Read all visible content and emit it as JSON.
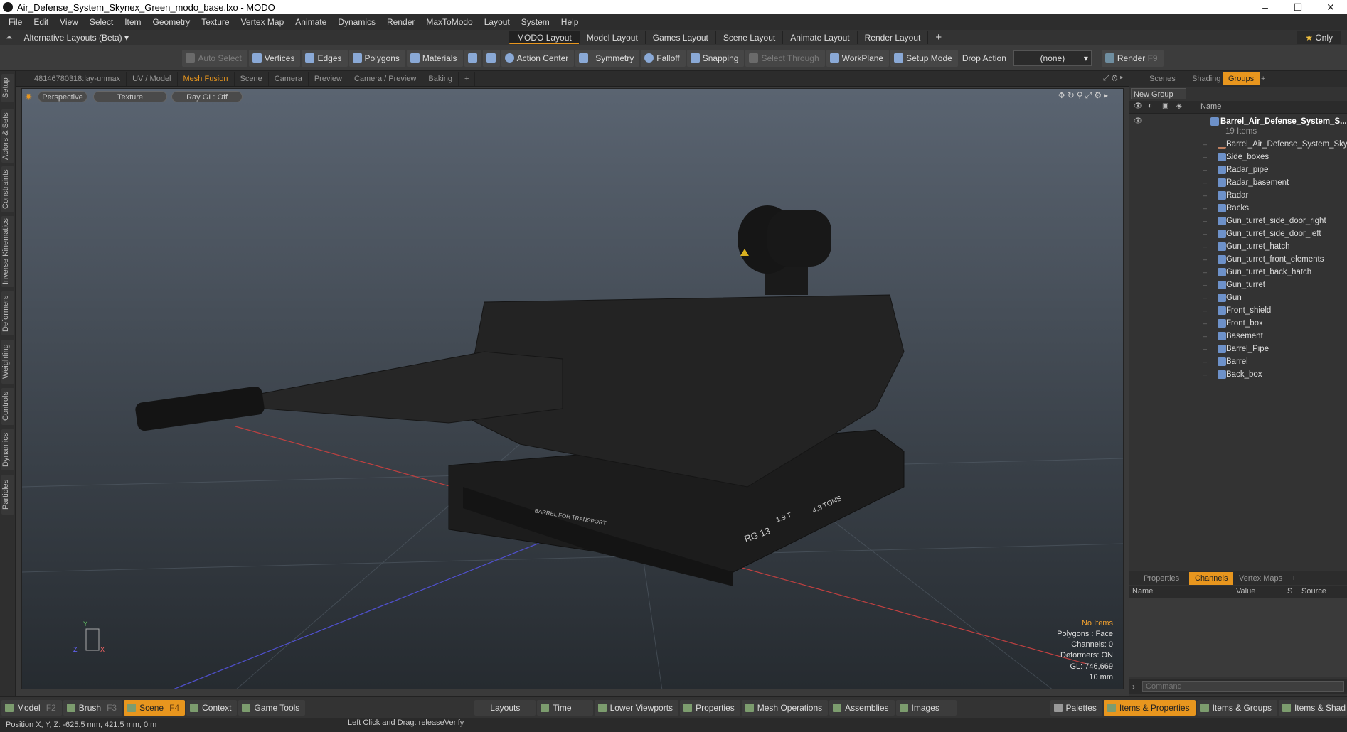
{
  "window": {
    "title": "Air_Defense_System_Skynex_Green_modo_base.lxo - MODO",
    "minimize": "–",
    "maximize": "☐",
    "close": "✕"
  },
  "menu": [
    "File",
    "Edit",
    "View",
    "Select",
    "Item",
    "Geometry",
    "Texture",
    "Vertex Map",
    "Animate",
    "Dynamics",
    "Render",
    "MaxToModo",
    "Layout",
    "System",
    "Help"
  ],
  "layout_bar": {
    "alt_layouts": "Alternative Layouts (Beta)",
    "tabs": [
      "MODO Layout",
      "Model Layout",
      "Games Layout",
      "Scene Layout",
      "Animate Layout",
      "Render Layout"
    ],
    "active_tab": "MODO Layout",
    "add": "+",
    "only": "Only"
  },
  "toolbar": {
    "auto_select": "Auto Select",
    "vertices": "Vertices",
    "edges": "Edges",
    "polygons": "Polygons",
    "materials": "Materials",
    "action_center": "Action Center",
    "symmetry": "Symmetry",
    "falloff": "Falloff",
    "snapping": "Snapping",
    "select_through": "Select Through",
    "workplane": "WorkPlane",
    "setup_mode": "Setup Mode",
    "drop_action": "Drop Action",
    "drop_value": "(none)",
    "render": "Render",
    "render_key": "F9"
  },
  "left_tabs": [
    "Setup",
    "Actors & Sets",
    "Constraints",
    "Inverse Kinematics",
    "Deformers",
    "Weighting",
    "Controls",
    "Dynamics",
    "Particles"
  ],
  "viewport_tabs": [
    "48146780318:lay-unmax",
    "UV / Model",
    "Mesh Fusion",
    "Scene",
    "Camera",
    "Preview",
    "Camera / Preview",
    "Baking"
  ],
  "viewport_tab_active": "Mesh Fusion",
  "viewport": {
    "view": "Perspective",
    "shading": "Texture",
    "raygl": "Ray GL: Off",
    "info": {
      "items": "No Items",
      "polygons": "Polygons : Face",
      "channels": "Channels: 0",
      "deformers": "Deformers: ON",
      "gl": "GL: 746,669",
      "scale": "10 mm"
    },
    "model_labels": {
      "barrel_transport": "BARREL FOR TRANSPORT",
      "rg": "RG 13",
      "weight": "4.3 TONS",
      "mark": "1.9 T"
    }
  },
  "right_panel": {
    "tabs": [
      "Scenes",
      "Shading",
      "Groups"
    ],
    "active_tab": "Groups",
    "new_group": "New Group",
    "col_name": "Name",
    "root": "Barrel_Air_Defense_System_S...",
    "root_count": "19 Items",
    "items": [
      "Barrel_Air_Defense_System_Sky ...",
      "Side_boxes",
      "Radar_pipe",
      "Radar_basement",
      "Radar",
      "Racks",
      "Gun_turret_side_door_right",
      "Gun_turret_side_door_left",
      "Gun_turret_hatch",
      "Gun_turret_front_elements",
      "Gun_turret_back_hatch",
      "Gun_turret",
      "Gun",
      "Front_shield",
      "Front_box",
      "Basement",
      "Barrel_Pipe",
      "Barrel",
      "Back_box"
    ],
    "lower_tabs": [
      "Properties",
      "Channels",
      "Vertex Maps"
    ],
    "lower_active": "Channels",
    "channel_cols": [
      "Name",
      "Value",
      "S",
      "Source"
    ],
    "command_placeholder": "Command"
  },
  "bottom_bar": {
    "left": [
      {
        "label": "Model",
        "key": "F2"
      },
      {
        "label": "Brush",
        "key": "F3"
      },
      {
        "label": "Scene",
        "key": "F4"
      },
      {
        "label": "Context",
        "key": ""
      },
      {
        "label": "Game Tools",
        "key": ""
      }
    ],
    "active": "Scene",
    "center": [
      "Layouts",
      "Time",
      "Lower Viewports",
      "Properties",
      "Mesh Operations",
      "Assemblies",
      "Images"
    ],
    "right": [
      "Palettes",
      "Items & Properties",
      "Items & Groups",
      "Items & Shad"
    ],
    "right_active": "Items & Properties"
  },
  "status": {
    "position": "Position X, Y, Z:  -625.5 mm, 421.5 mm, 0 m",
    "hint": "Left Click and Drag:  releaseVerify"
  },
  "colors": {
    "accent": "#e8961e",
    "item_icon": "#6d91c9"
  }
}
